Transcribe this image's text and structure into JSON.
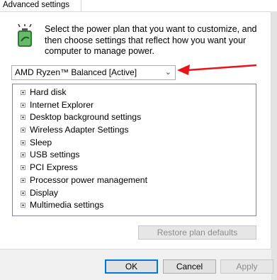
{
  "tab": {
    "label": "Advanced settings"
  },
  "intro_text": "Select the power plan that you want to customize, and then choose settings that reflect how you want your computer to manage power.",
  "plan_select": {
    "value": "AMD Ryzen™ Balanced [Active]"
  },
  "tree_items": [
    "Hard disk",
    "Internet Explorer",
    "Desktop background settings",
    "Wireless Adapter Settings",
    "Sleep",
    "USB settings",
    "PCI Express",
    "Processor power management",
    "Display",
    "Multimedia settings"
  ],
  "buttons": {
    "restore": "Restore plan defaults",
    "ok": "OK",
    "cancel": "Cancel",
    "apply": "Apply"
  },
  "colors": {
    "annotation_arrow": "#e8141b",
    "default_button_border": "#0078d7"
  }
}
